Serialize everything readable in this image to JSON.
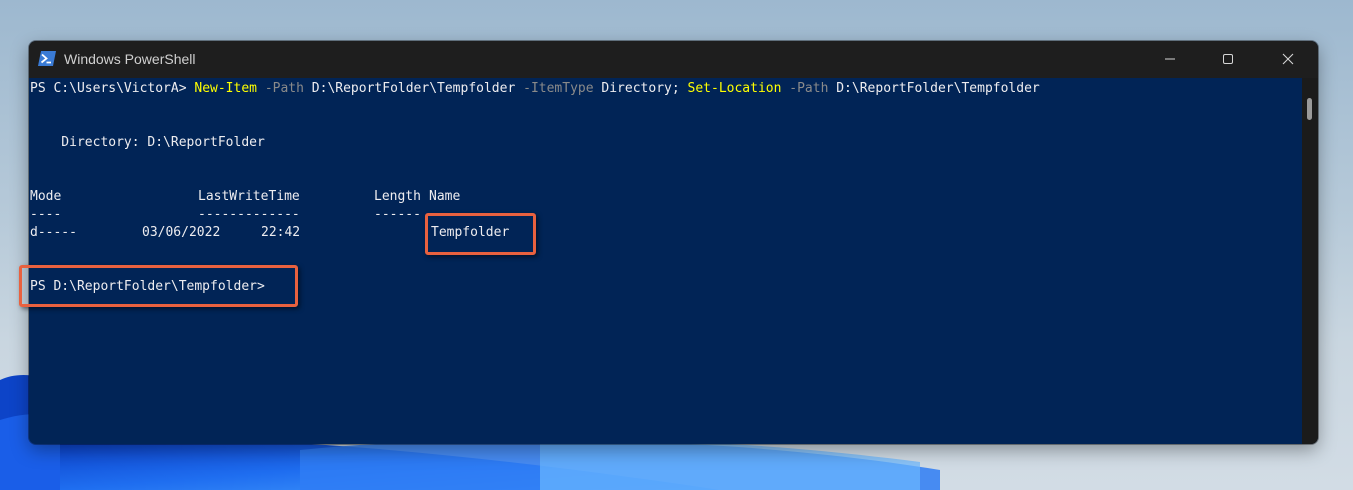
{
  "window": {
    "title": "Windows PowerShell"
  },
  "console": {
    "command_line": {
      "prompt": "PS C:\\Users\\VictorA> ",
      "cmd1": "New-Item",
      "param1": "-Path",
      "arg1": "D:\\ReportFolder\\Tempfolder",
      "param2": "-ItemType",
      "arg2": "Directory;",
      "cmd2": "Set-Location",
      "param3": "-Path",
      "arg3": "D:\\ReportFolder\\Tempfolder"
    },
    "directory_line": "    Directory: D:\\ReportFolder",
    "table": {
      "header": {
        "mode": "Mode",
        "lastwritetime": "LastWriteTime",
        "length": "Length",
        "name": "Name"
      },
      "separator": {
        "mode": "----",
        "lastwritetime": "-------------",
        "length": "------"
      },
      "row": {
        "mode": "d-----",
        "date": "03/06/2022",
        "time": "22:42",
        "name": "Tempfolder"
      }
    },
    "final_prompt": "PS D:\\ReportFolder\\Tempfolder>"
  },
  "colors": {
    "console_background": "#012456",
    "console_text": "#eeedf0",
    "command_color": "#ffff00",
    "parameter_color": "#8a8a8a",
    "titlebar": "#1e1e1e",
    "highlight_box": "#e8613f"
  },
  "icons": {
    "app": "powershell-icon",
    "minimize": "minimize-icon",
    "maximize": "maximize-icon",
    "close": "close-icon"
  }
}
